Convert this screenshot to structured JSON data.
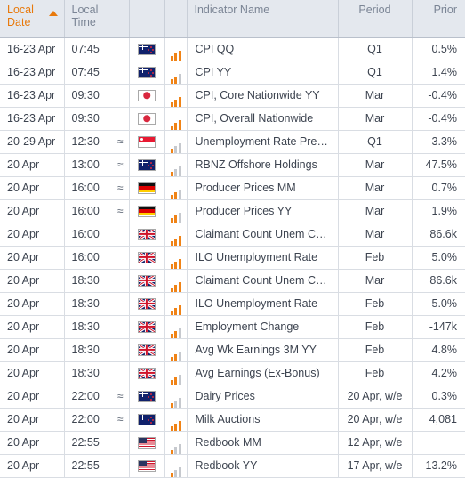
{
  "table": {
    "columns": [
      {
        "key": "local_date",
        "label": "Local Date",
        "sorted": true,
        "sort_dir": "asc"
      },
      {
        "key": "local_time",
        "label": "Local Time"
      },
      {
        "key": "country",
        "label": ""
      },
      {
        "key": "importance",
        "label": ""
      },
      {
        "key": "indicator",
        "label": "Indicator Name"
      },
      {
        "key": "period",
        "label": "Period"
      },
      {
        "key": "prior",
        "label": "Prior"
      }
    ],
    "header": {
      "local_date": "Local Date",
      "local_time": "Local Time",
      "country": "",
      "importance": "",
      "indicator_name": "Indicator Name",
      "period": "Period",
      "prior": "Prior"
    },
    "sort_indicator": "ascending-triangle",
    "approx_symbol": "≈",
    "rows": [
      {
        "date": "16-23 Apr",
        "time": "07:45",
        "approx": false,
        "country": "New Zealand",
        "flag": "nz",
        "importance": 3,
        "indicator": "CPI QQ",
        "period": "Q1",
        "prior": "0.5%"
      },
      {
        "date": "16-23 Apr",
        "time": "07:45",
        "approx": false,
        "country": "New Zealand",
        "flag": "nz",
        "importance": 2,
        "indicator": "CPI YY",
        "period": "Q1",
        "prior": "1.4%"
      },
      {
        "date": "16-23 Apr",
        "time": "09:30",
        "approx": false,
        "country": "Japan",
        "flag": "jp",
        "importance": 3,
        "indicator": "CPI, Core Nationwide YY",
        "period": "Mar",
        "prior": "-0.4%"
      },
      {
        "date": "16-23 Apr",
        "time": "09:30",
        "approx": false,
        "country": "Japan",
        "flag": "jp",
        "importance": 3,
        "indicator": "CPI, Overall Nationwide",
        "period": "Mar",
        "prior": "-0.4%"
      },
      {
        "date": "20-29 Apr",
        "time": "12:30",
        "approx": true,
        "country": "Singapore",
        "flag": "sg",
        "importance": 1,
        "indicator": "Unemployment Rate Prel…",
        "period": "Q1",
        "prior": "3.3%"
      },
      {
        "date": "20 Apr",
        "time": "13:00",
        "approx": true,
        "country": "New Zealand",
        "flag": "nz",
        "importance": 1,
        "indicator": "RBNZ Offshore Holdings",
        "period": "Mar",
        "prior": "47.5%"
      },
      {
        "date": "20 Apr",
        "time": "16:00",
        "approx": true,
        "country": "Germany",
        "flag": "de",
        "importance": 2,
        "indicator": "Producer Prices MM",
        "period": "Mar",
        "prior": "0.7%"
      },
      {
        "date": "20 Apr",
        "time": "16:00",
        "approx": true,
        "country": "Germany",
        "flag": "de",
        "importance": 2,
        "indicator": "Producer Prices YY",
        "period": "Mar",
        "prior": "1.9%"
      },
      {
        "date": "20 Apr",
        "time": "16:00",
        "approx": false,
        "country": "United Kingdom",
        "flag": "gb",
        "importance": 3,
        "indicator": "Claimant Count Unem C…",
        "period": "Mar",
        "prior": "86.6k"
      },
      {
        "date": "20 Apr",
        "time": "16:00",
        "approx": false,
        "country": "United Kingdom",
        "flag": "gb",
        "importance": 3,
        "indicator": "ILO Unemployment Rate",
        "period": "Feb",
        "prior": "5.0%"
      },
      {
        "date": "20 Apr",
        "time": "18:30",
        "approx": false,
        "country": "United Kingdom",
        "flag": "gb",
        "importance": 3,
        "indicator": "Claimant Count Unem C…",
        "period": "Mar",
        "prior": "86.6k"
      },
      {
        "date": "20 Apr",
        "time": "18:30",
        "approx": false,
        "country": "United Kingdom",
        "flag": "gb",
        "importance": 3,
        "indicator": "ILO Unemployment Rate",
        "period": "Feb",
        "prior": "5.0%"
      },
      {
        "date": "20 Apr",
        "time": "18:30",
        "approx": false,
        "country": "United Kingdom",
        "flag": "gb",
        "importance": 2,
        "indicator": "Employment Change",
        "period": "Feb",
        "prior": "-147k"
      },
      {
        "date": "20 Apr",
        "time": "18:30",
        "approx": false,
        "country": "United Kingdom",
        "flag": "gb",
        "importance": 2,
        "indicator": "Avg Wk Earnings 3M YY",
        "period": "Feb",
        "prior": "4.8%"
      },
      {
        "date": "20 Apr",
        "time": "18:30",
        "approx": false,
        "country": "United Kingdom",
        "flag": "gb",
        "importance": 2,
        "indicator": "Avg Earnings (Ex-Bonus)",
        "period": "Feb",
        "prior": "4.2%"
      },
      {
        "date": "20 Apr",
        "time": "22:00",
        "approx": true,
        "country": "New Zealand",
        "flag": "nz",
        "importance": 1,
        "indicator": "Dairy Prices",
        "period": "20 Apr, w/e",
        "prior": "0.3%"
      },
      {
        "date": "20 Apr",
        "time": "22:00",
        "approx": true,
        "country": "New Zealand",
        "flag": "nz",
        "importance": 3,
        "indicator": "Milk Auctions",
        "period": "20 Apr, w/e",
        "prior": "4,081"
      },
      {
        "date": "20 Apr",
        "time": "22:55",
        "approx": false,
        "country": "United States",
        "flag": "us",
        "importance": 1,
        "indicator": "Redbook MM",
        "period": "12 Apr, w/e",
        "prior": ""
      },
      {
        "date": "20 Apr",
        "time": "22:55",
        "approx": false,
        "country": "United States",
        "flag": "us",
        "importance": 1,
        "indicator": "Redbook YY",
        "period": "17 Apr, w/e",
        "prior": "13.2%"
      }
    ]
  },
  "colors": {
    "header_bg": "#e4e8ee",
    "header_text": "#7b8595",
    "sorted_header_text": "#e8790b",
    "sort_triangle": "#e8790b",
    "row_text": "#3d4450",
    "grid_line": "#d9dde3",
    "importance_on": "#f08316",
    "importance_off": "#c6c9ce",
    "row_bg": "#ffffff"
  }
}
